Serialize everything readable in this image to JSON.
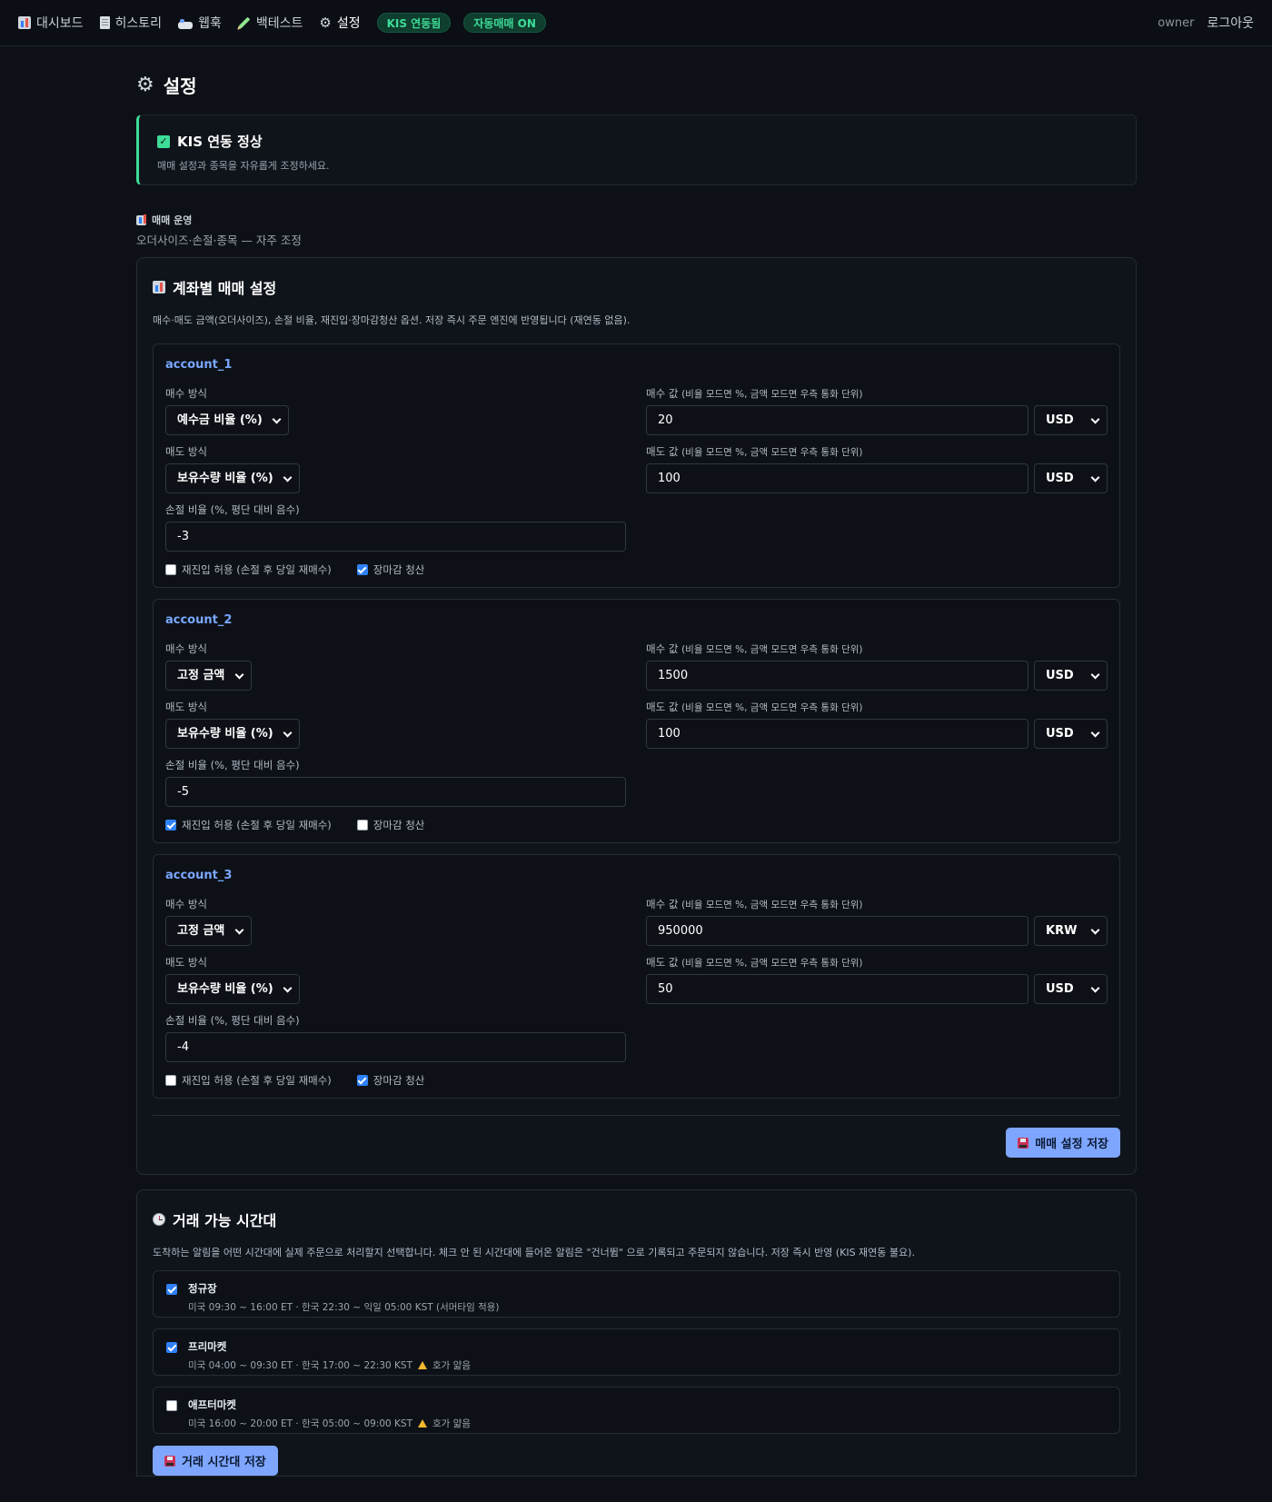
{
  "nav": {
    "items": [
      {
        "label": "대시보드",
        "icon": "dashboard-icon"
      },
      {
        "label": "히스토리",
        "icon": "history-icon"
      },
      {
        "label": "웹훅",
        "icon": "webhook-icon"
      },
      {
        "label": "백테스트",
        "icon": "pencil-icon"
      },
      {
        "label": "설정",
        "icon": "gear-icon"
      }
    ],
    "badges": [
      "KIS 연동됨",
      "자동매매 ON"
    ],
    "user": "owner",
    "logout": "로그아웃"
  },
  "page": {
    "title": "설정"
  },
  "banner": {
    "title": "KIS 연동 정상",
    "sub": "매매 설정과 종목을 자유롭게 조정하세요."
  },
  "section": {
    "label": "매매 운영",
    "sub": "오더사이즈·손절·종목 — 자주 조정"
  },
  "trading": {
    "title": "계좌별 매매 설정",
    "desc": "매수·매도 금액(오더사이즈), 손절 비율, 재진입·장마감청산 옵션. 저장 즉시 주문 엔진에 반영됩니다 (재연동 없음).",
    "labels": {
      "buy_method": "매수 방식",
      "sell_method": "매도 방식",
      "buy_value": "매수 값",
      "sell_value": "매도 값",
      "value_hint": "(비율 모드면 %, 금액 모드면 우측 통화 단위)",
      "stop_loss": "손절 비율 (%, 평단 대비 음수)",
      "reentry": "재진입 허용 (손절 후 당일 재매수)",
      "close_exit": "장마감 청산"
    },
    "accounts": [
      {
        "name": "account_1",
        "buy_method": "예수금 비율 (%)",
        "buy_value": "20",
        "buy_currency": "USD",
        "sell_method": "보유수량 비율 (%)",
        "sell_value": "100",
        "sell_currency": "USD",
        "stop_loss": "-3",
        "reentry": false,
        "close_exit": true
      },
      {
        "name": "account_2",
        "buy_method": "고정 금액",
        "buy_value": "1500",
        "buy_currency": "USD",
        "sell_method": "보유수량 비율 (%)",
        "sell_value": "100",
        "sell_currency": "USD",
        "stop_loss": "-5",
        "reentry": true,
        "close_exit": false
      },
      {
        "name": "account_3",
        "buy_method": "고정 금액",
        "buy_value": "950000",
        "buy_currency": "KRW",
        "sell_method": "보유수량 비율 (%)",
        "sell_value": "50",
        "sell_currency": "USD",
        "stop_loss": "-4",
        "reentry": false,
        "close_exit": true
      }
    ],
    "save_label": "매매 설정 저장"
  },
  "hours": {
    "title": "거래 가능 시간대",
    "desc": "도착하는 알림을 어떤 시간대에 실제 주문으로 처리할지 선택합니다. 체크 안 된 시간대에 들어온 알림은 \"건너뜀\" 으로 기록되고 주문되지 않습니다. 저장 즉시 반영 (KIS 재연동 불요).",
    "sessions": [
      {
        "name": "정규장",
        "desc": "미국 09:30 ~ 16:00 ET · 한국 22:30 ~ 익일 05:00 KST (서머타임 적용)",
        "warn": "",
        "checked": true
      },
      {
        "name": "프리마켓",
        "desc": "미국 04:00 ~ 09:30 ET · 한국 17:00 ~ 22:30 KST",
        "warn": "호가 얇음",
        "checked": true
      },
      {
        "name": "애프터마켓",
        "desc": "미국 16:00 ~ 20:00 ET · 한국 05:00 ~ 09:00 KST",
        "warn": "호가 얇음",
        "checked": false
      }
    ],
    "save_label": "거래 시간대 저장"
  }
}
